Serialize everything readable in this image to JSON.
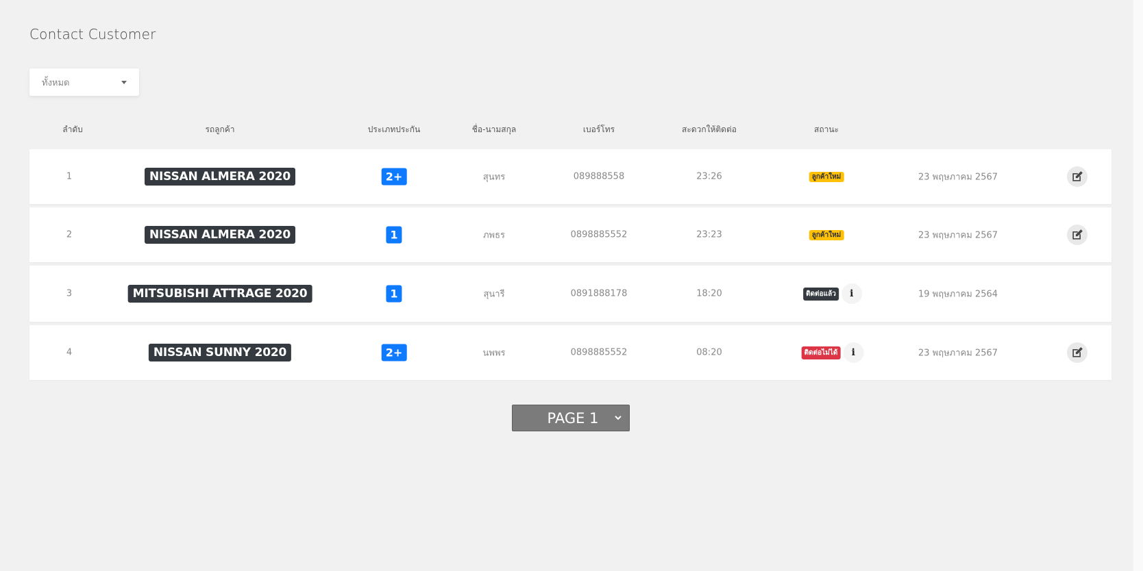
{
  "page_title": "Contact Customer",
  "filter": {
    "selected": "ทั้งหมด"
  },
  "table": {
    "headers": [
      "ลำดับ",
      "รถลูกค้า",
      "ประเภทประกัน",
      "ชื่อ-นามสกุล",
      "เบอร์โทร",
      "สะดวกให้ติดต่อ",
      "สถานะ"
    ],
    "rows": [
      {
        "no": "1",
        "car": "NISSAN ALMERA 2020",
        "insurance": "2+",
        "name": "สุนทร",
        "phone": "089888558",
        "time": "23:26",
        "status": "ลูกค้าใหม่",
        "status_type": "new",
        "has_info": false,
        "date": "23 พฤษภาคม 2567",
        "has_edit": true
      },
      {
        "no": "2",
        "car": "NISSAN ALMERA 2020",
        "insurance": "1",
        "name": "ภพธร",
        "phone": "0898885552",
        "time": "23:23",
        "status": "ลูกค้าใหม่",
        "status_type": "new",
        "has_info": false,
        "date": "23 พฤษภาคม 2567",
        "has_edit": true
      },
      {
        "no": "3",
        "car": "MITSUBISHI ATTRAGE 2020",
        "insurance": "1",
        "name": "สุนารี",
        "phone": "0891888178",
        "time": "18:20",
        "status": "ติดต่อแล้ว",
        "status_type": "done",
        "has_info": true,
        "date": "19 พฤษภาคม 2564",
        "has_edit": false
      },
      {
        "no": "4",
        "car": "NISSAN SUNNY 2020",
        "insurance": "2+",
        "name": "นพพร",
        "phone": "0898885552",
        "time": "08:20",
        "status": "ติดต่อไม่ได้",
        "status_type": "fail",
        "has_info": true,
        "date": "23 พฤษภาคม 2567",
        "has_edit": true
      }
    ]
  },
  "pagination": {
    "label": "PAGE 1"
  },
  "icons": {
    "info": "info-icon",
    "edit": "edit-icon",
    "filter_caret": "caret-down-icon",
    "pager_chevron": "chevron-down-icon"
  },
  "colors": {
    "insurance_badge": "#0d7aff",
    "car_badge": "#343a40",
    "status_new": "#ffc107",
    "status_done": "#343a40",
    "status_fail": "#dc3545"
  }
}
